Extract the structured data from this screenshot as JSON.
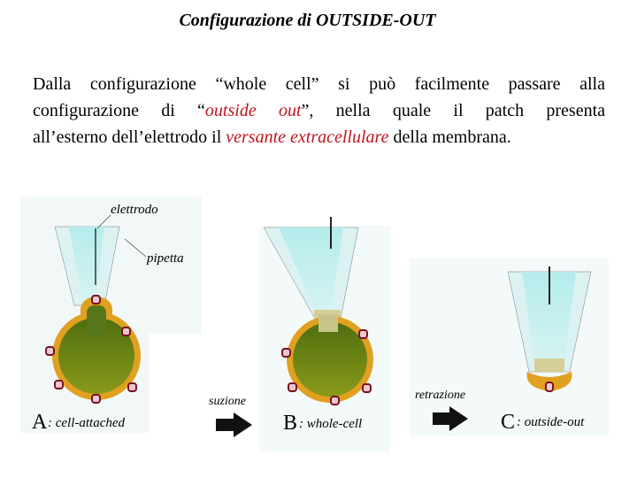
{
  "title": "Configurazione di OUTSIDE-OUT",
  "paragraph": {
    "line1": "Dalla configurazione “whole cell” si può facilmente passare alla",
    "line2_a": "configurazione di “",
    "line2_red": "outside out",
    "line2_b": "”, nella quale il patch presenta",
    "line3_a": "all’esterno dell’elettrodo il ",
    "line3_red": "versante extracellulare",
    "line3_b": " della membrana."
  },
  "figure": {
    "label_electrode": "elettrodo",
    "label_pipette": "pipetta",
    "panel_a_letter": "A",
    "panel_a_label": ": cell-attached",
    "arrow1_label": "suzione",
    "panel_b_letter": "B",
    "panel_b_label": ": whole-cell",
    "arrow2_label": "retrazione",
    "panel_c_letter": "C",
    "panel_c_label": ": outside-out",
    "colors": {
      "pipette": "#c6eeee",
      "cell": "#6f8a16",
      "membrane": "#e0a020",
      "channel": "#7a1020",
      "accent_text": "#c0141c"
    }
  }
}
